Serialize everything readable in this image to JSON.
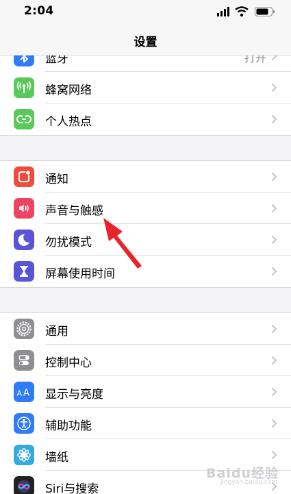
{
  "status_bar": {
    "time": "2:04",
    "icons": [
      "cellular-signal-icon",
      "wifi-icon",
      "battery-icon"
    ]
  },
  "nav": {
    "title": "设置"
  },
  "groups": [
    {
      "items": [
        {
          "label": "蓝牙",
          "value": "打开",
          "icon": "bluetooth-icon",
          "color": "#2f7cf6"
        },
        {
          "label": "蜂窝网络",
          "icon": "cellular-antenna-icon",
          "color": "#5ac85a"
        },
        {
          "label": "个人热点",
          "icon": "hotspot-icon",
          "color": "#5ac85a"
        }
      ]
    },
    {
      "items": [
        {
          "label": "通知",
          "icon": "notification-icon",
          "color": "#ef4b3f"
        },
        {
          "label": "声音与触感",
          "icon": "speaker-icon",
          "color": "#ec4462"
        },
        {
          "label": "勿扰模式",
          "icon": "moon-icon",
          "color": "#5a55d6"
        },
        {
          "label": "屏幕使用时间",
          "icon": "hourglass-icon",
          "color": "#5a55d6"
        }
      ]
    },
    {
      "items": [
        {
          "label": "通用",
          "icon": "gear-icon",
          "color": "#8e8e93"
        },
        {
          "label": "控制中心",
          "icon": "toggle-switches-icon",
          "color": "#8e8e93"
        },
        {
          "label": "显示与亮度",
          "icon": "text-size-icon",
          "color": "#2f7cf6"
        },
        {
          "label": "辅助功能",
          "icon": "accessibility-icon",
          "color": "#2f7cf6"
        },
        {
          "label": "墙纸",
          "icon": "wallpaper-flower-icon",
          "color": "#35aadc"
        },
        {
          "label": "Siri与搜索",
          "icon": "siri-icon",
          "color": "#222222"
        }
      ]
    }
  ],
  "annotation": {
    "icon": "red-arrow-icon",
    "color": "#e8242a"
  },
  "watermark": {
    "text": "Baidu经验",
    "sub": "jingyan.baidu.com"
  }
}
